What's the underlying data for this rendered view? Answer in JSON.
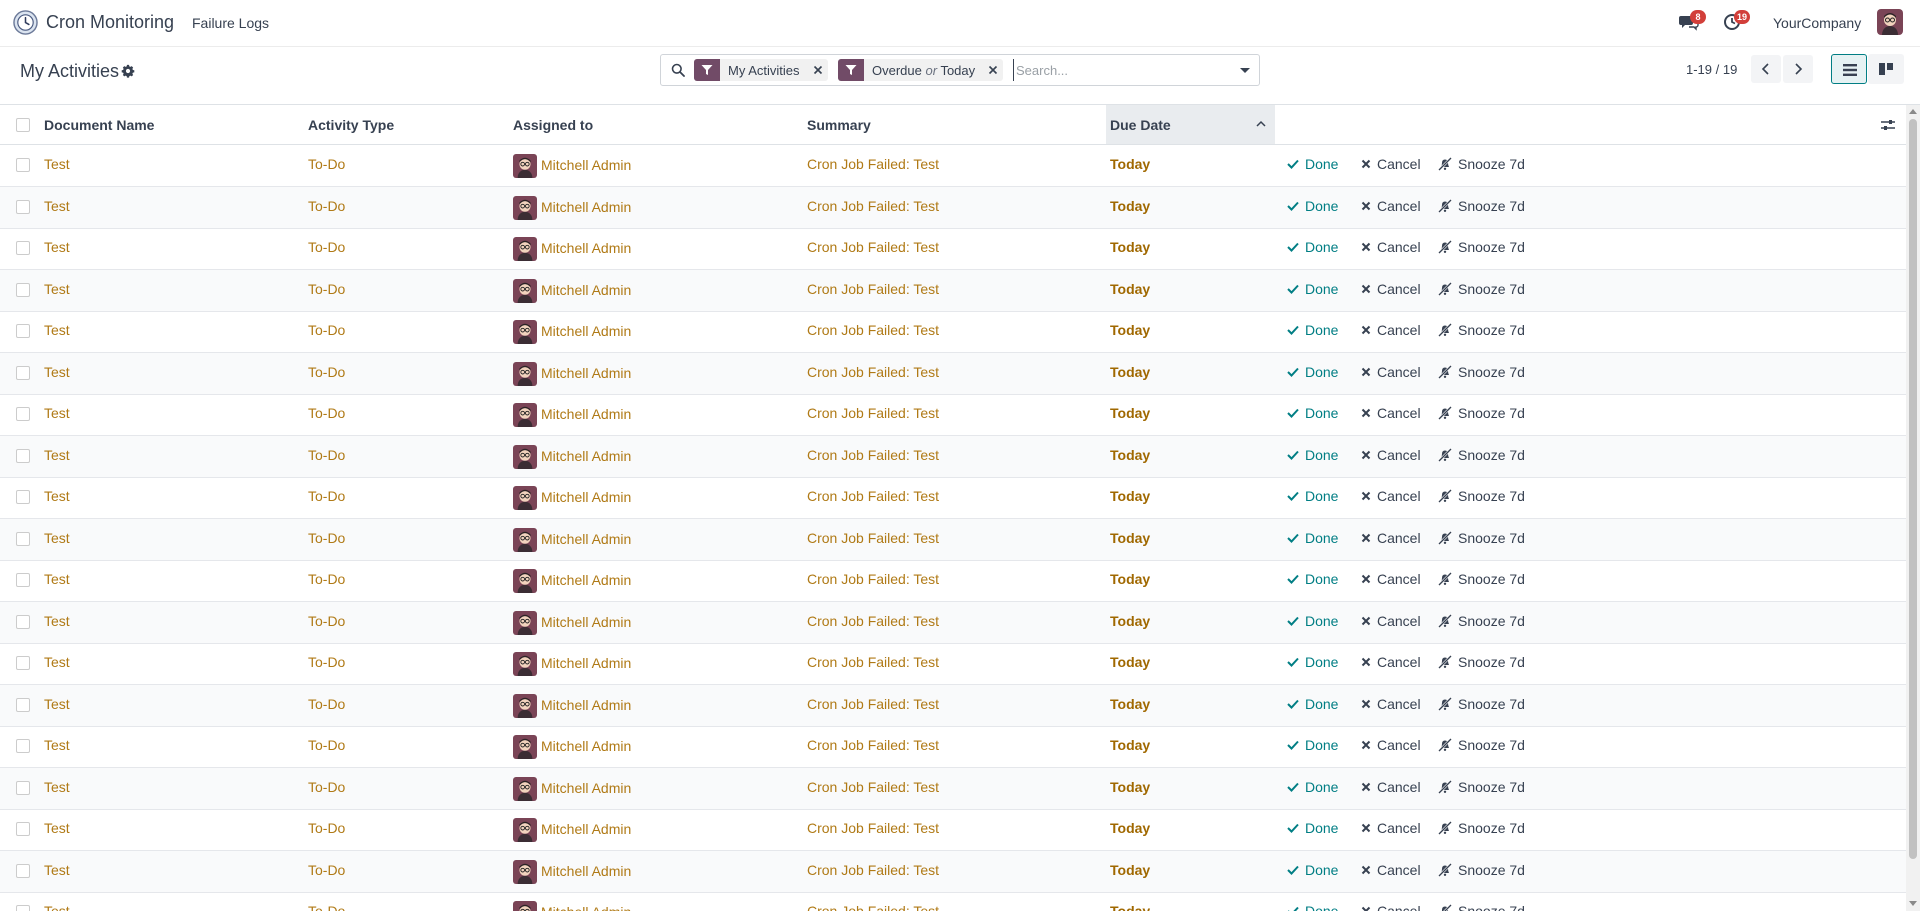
{
  "navbar": {
    "app_name": "Cron Monitoring",
    "menu_link": "Failure Logs",
    "messages_count": "8",
    "activities_count": "19",
    "company": "YourCompany"
  },
  "control_panel": {
    "title": "My Activities",
    "search": {
      "facets": [
        {
          "values": [
            "My Activities"
          ]
        },
        {
          "values": [
            "Overdue",
            "Today"
          ],
          "separator": "or"
        }
      ],
      "placeholder": "Search..."
    },
    "pager": "1-19 / 19",
    "active_view": "list"
  },
  "table": {
    "columns": [
      "Document Name",
      "Activity Type",
      "Assigned to",
      "Summary",
      "Due Date"
    ],
    "sort": {
      "column": "Due Date",
      "direction": "ascending"
    },
    "actions": [
      "Done",
      "Cancel",
      "Snooze 7d"
    ],
    "rows": [
      {
        "document": "Test",
        "type": "To-Do",
        "assigned": "Mitchell Admin",
        "summary": "Cron Job Failed: Test",
        "due": "Today"
      },
      {
        "document": "Test",
        "type": "To-Do",
        "assigned": "Mitchell Admin",
        "summary": "Cron Job Failed: Test",
        "due": "Today"
      },
      {
        "document": "Test",
        "type": "To-Do",
        "assigned": "Mitchell Admin",
        "summary": "Cron Job Failed: Test",
        "due": "Today"
      },
      {
        "document": "Test",
        "type": "To-Do",
        "assigned": "Mitchell Admin",
        "summary": "Cron Job Failed: Test",
        "due": "Today"
      },
      {
        "document": "Test",
        "type": "To-Do",
        "assigned": "Mitchell Admin",
        "summary": "Cron Job Failed: Test",
        "due": "Today"
      },
      {
        "document": "Test",
        "type": "To-Do",
        "assigned": "Mitchell Admin",
        "summary": "Cron Job Failed: Test",
        "due": "Today"
      },
      {
        "document": "Test",
        "type": "To-Do",
        "assigned": "Mitchell Admin",
        "summary": "Cron Job Failed: Test",
        "due": "Today"
      },
      {
        "document": "Test",
        "type": "To-Do",
        "assigned": "Mitchell Admin",
        "summary": "Cron Job Failed: Test",
        "due": "Today"
      },
      {
        "document": "Test",
        "type": "To-Do",
        "assigned": "Mitchell Admin",
        "summary": "Cron Job Failed: Test",
        "due": "Today"
      },
      {
        "document": "Test",
        "type": "To-Do",
        "assigned": "Mitchell Admin",
        "summary": "Cron Job Failed: Test",
        "due": "Today"
      },
      {
        "document": "Test",
        "type": "To-Do",
        "assigned": "Mitchell Admin",
        "summary": "Cron Job Failed: Test",
        "due": "Today"
      },
      {
        "document": "Test",
        "type": "To-Do",
        "assigned": "Mitchell Admin",
        "summary": "Cron Job Failed: Test",
        "due": "Today"
      },
      {
        "document": "Test",
        "type": "To-Do",
        "assigned": "Mitchell Admin",
        "summary": "Cron Job Failed: Test",
        "due": "Today"
      },
      {
        "document": "Test",
        "type": "To-Do",
        "assigned": "Mitchell Admin",
        "summary": "Cron Job Failed: Test",
        "due": "Today"
      },
      {
        "document": "Test",
        "type": "To-Do",
        "assigned": "Mitchell Admin",
        "summary": "Cron Job Failed: Test",
        "due": "Today"
      },
      {
        "document": "Test",
        "type": "To-Do",
        "assigned": "Mitchell Admin",
        "summary": "Cron Job Failed: Test",
        "due": "Today"
      },
      {
        "document": "Test",
        "type": "To-Do",
        "assigned": "Mitchell Admin",
        "summary": "Cron Job Failed: Test",
        "due": "Today"
      },
      {
        "document": "Test",
        "type": "To-Do",
        "assigned": "Mitchell Admin",
        "summary": "Cron Job Failed: Test",
        "due": "Today"
      },
      {
        "document": "Test",
        "type": "To-Do",
        "assigned": "Mitchell Admin",
        "summary": "Cron Job Failed: Test",
        "due": "Today"
      }
    ]
  },
  "icons": {
    "app": "clock-icon",
    "messages": "chat-bubbles-icon",
    "activities": "clock-icon",
    "gear": "gear-icon",
    "search": "search-icon",
    "filter": "filter-icon",
    "remove_facet": "close-icon",
    "done": "check-icon",
    "cancel": "times-icon",
    "snooze": "bell-slash-icon"
  },
  "colors": {
    "brand": "#714b67",
    "link": "#b07a16",
    "today": "#a06800",
    "done": "#017e84",
    "badge": "#d23f3a"
  }
}
